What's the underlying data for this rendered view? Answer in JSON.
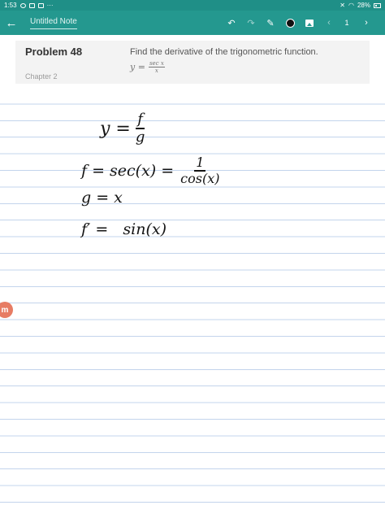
{
  "status_bar": {
    "time": "1:53",
    "extras": "···",
    "battery_text": "28%"
  },
  "toolbar": {
    "note_title": "Untitled Note",
    "page_number": "1",
    "icons": [
      "back-arrow-icon",
      "undo-icon",
      "redo-icon",
      "pen-icon",
      "color-picker-icon",
      "image-icon",
      "prev-page-icon",
      "next-page-icon"
    ],
    "pen_color": "#111111",
    "accent_color": "#24988f"
  },
  "problem": {
    "title": "Problem 48",
    "chapter": "Chapter 2",
    "question": "Find the derivative of the trigonometric function.",
    "formula_lhs": "y =",
    "formula_num": "sec x",
    "formula_den": "x"
  },
  "handwriting": {
    "line1_lhs": "y =",
    "line1_num": "f",
    "line1_den": "g",
    "line2_lhs": "f = sec(x) =",
    "line2_num": "1",
    "line2_den": "cos(x)",
    "line3": "g = x",
    "line4": "f′ =   sin(x)"
  },
  "badge": {
    "letter": "m"
  }
}
